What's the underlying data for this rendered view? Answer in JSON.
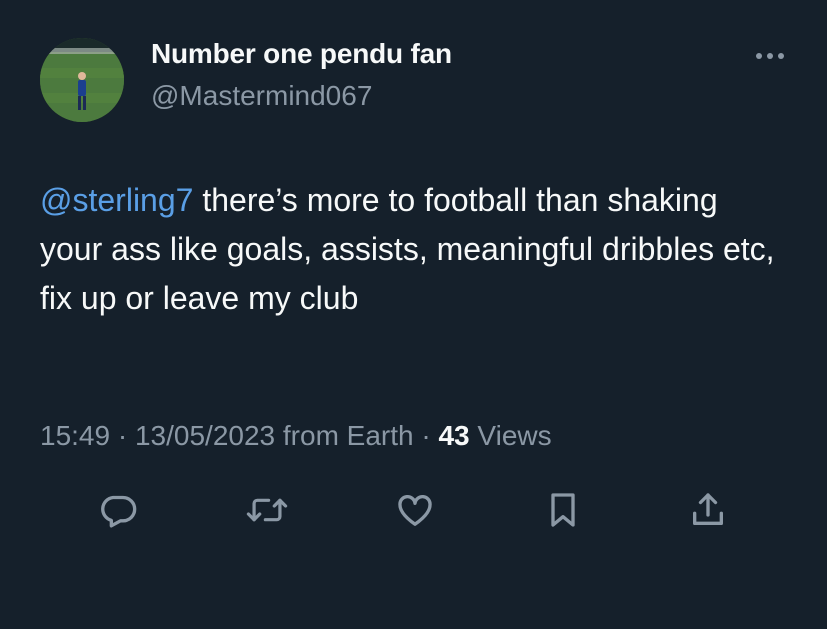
{
  "tweet": {
    "display_name": "Number one pendu fan",
    "handle": "@Mastermind067",
    "mention": "@sterling7",
    "text": " there’s more to football than shaking your ass like goals, assists, meaningful dribbles etc, fix up or leave my club",
    "time": "15:49",
    "date": "13/05/2023",
    "source": "from Earth",
    "separator": "·",
    "views_count": "43",
    "views_label": "Views"
  },
  "colors": {
    "background": "#15202b",
    "text": "#f7f9f9",
    "secondary": "#8b98a5",
    "link": "#5a9fe6"
  },
  "icons": {
    "more": "more-horizontal-icon",
    "reply": "reply-icon",
    "retweet": "retweet-icon",
    "like": "heart-icon",
    "bookmark": "bookmark-icon",
    "share": "share-icon"
  }
}
